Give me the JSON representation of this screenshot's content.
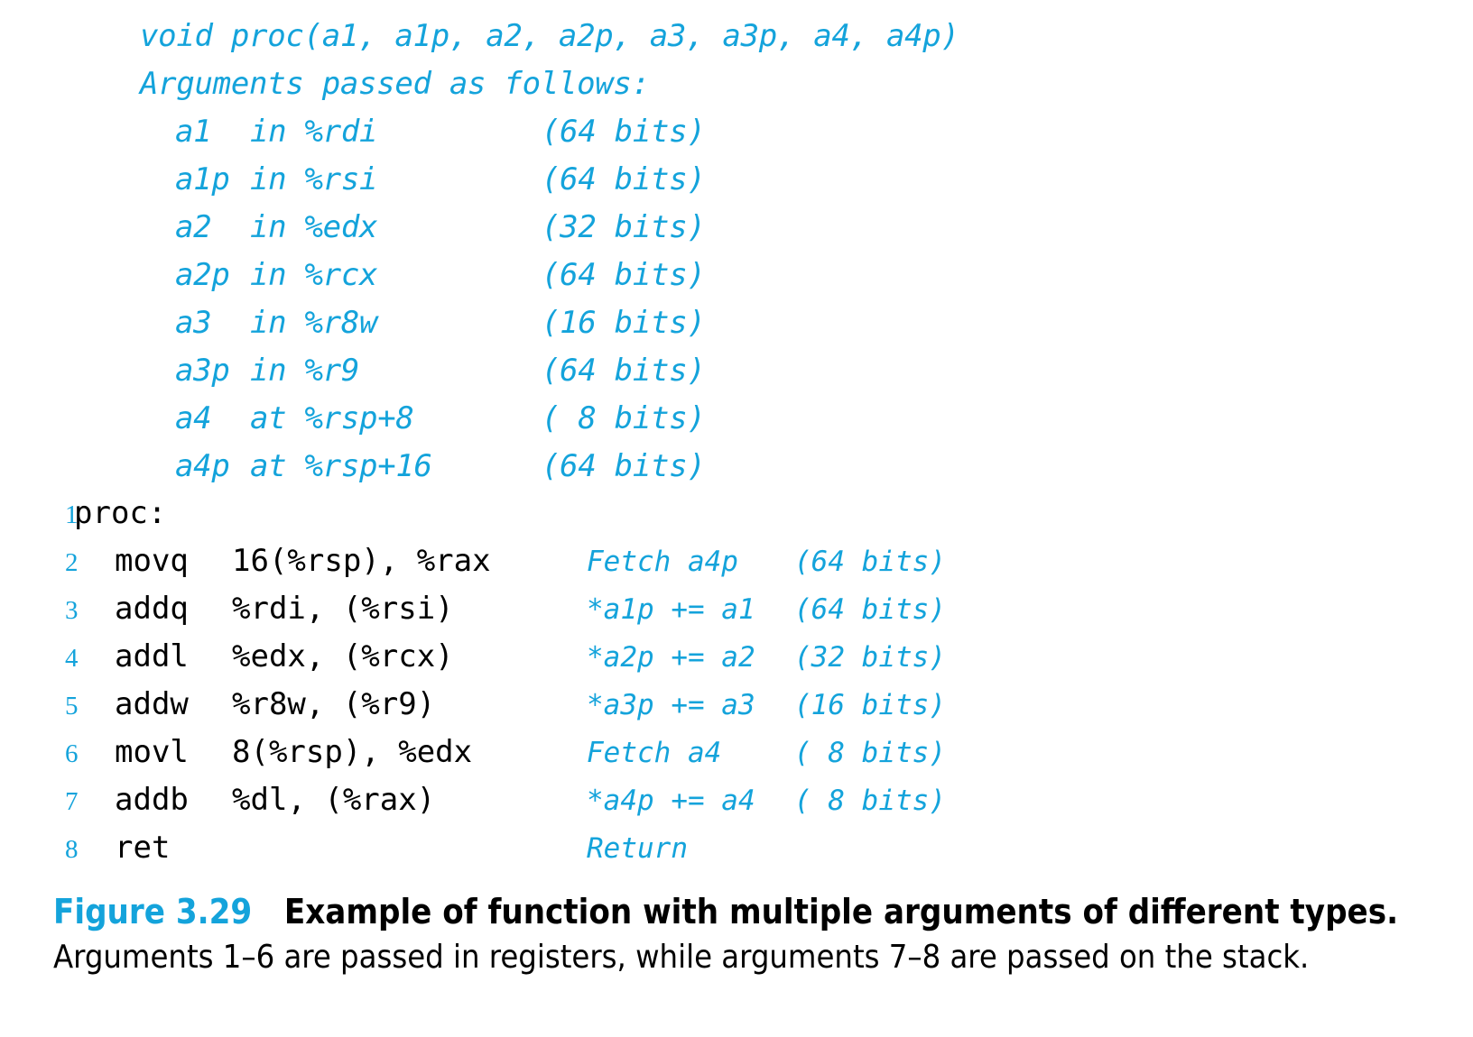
{
  "colors": {
    "accent": "#14a3db",
    "text": "#000000",
    "background": "#ffffff"
  },
  "c_source": {
    "signature": "void proc(a1, a1p, a2, a2p, a3, a3p, a4, a4p)",
    "intro": "Arguments passed as follows:",
    "arguments": [
      {
        "name": "a1",
        "location": "in %rdi",
        "bits": "(64 bits)"
      },
      {
        "name": "a1p",
        "location": "in %rsi",
        "bits": "(64 bits)"
      },
      {
        "name": "a2",
        "location": "in %edx",
        "bits": "(32 bits)"
      },
      {
        "name": "a2p",
        "location": "in %rcx",
        "bits": "(64 bits)"
      },
      {
        "name": "a3",
        "location": "in %r8w",
        "bits": "(16 bits)"
      },
      {
        "name": "a3p",
        "location": "in %r9",
        "bits": "(64 bits)"
      },
      {
        "name": "a4",
        "location": "at %rsp+8",
        "bits": "( 8 bits)"
      },
      {
        "name": "a4p",
        "location": "at %rsp+16",
        "bits": "(64 bits)"
      }
    ]
  },
  "assembly": {
    "lines": [
      {
        "num": "1",
        "label": "proc:",
        "mnemonic": "",
        "operands": "",
        "comment": "",
        "bits": ""
      },
      {
        "num": "2",
        "label": "",
        "mnemonic": "movq",
        "operands": "16(%rsp), %rax",
        "comment": "Fetch a4p",
        "bits": "(64 bits)"
      },
      {
        "num": "3",
        "label": "",
        "mnemonic": "addq",
        "operands": "%rdi, (%rsi)",
        "comment": "*a1p += a1",
        "bits": "(64 bits)"
      },
      {
        "num": "4",
        "label": "",
        "mnemonic": "addl",
        "operands": "%edx, (%rcx)",
        "comment": "*a2p += a2",
        "bits": "(32 bits)"
      },
      {
        "num": "5",
        "label": "",
        "mnemonic": "addw",
        "operands": "%r8w, (%r9)",
        "comment": "*a3p += a3",
        "bits": "(16 bits)"
      },
      {
        "num": "6",
        "label": "",
        "mnemonic": "movl",
        "operands": "8(%rsp), %edx",
        "comment": "Fetch a4",
        "bits": "( 8 bits)"
      },
      {
        "num": "7",
        "label": "",
        "mnemonic": "addb",
        "operands": "%dl, (%rax)",
        "comment": "*a4p += a4",
        "bits": "( 8 bits)"
      },
      {
        "num": "8",
        "label": "",
        "mnemonic": "ret",
        "operands": "",
        "comment": "Return",
        "bits": ""
      }
    ]
  },
  "caption": {
    "number": "Figure 3.29",
    "title": "Example of function with multiple arguments of different types.",
    "description": "Arguments 1–6 are passed in registers, while arguments 7–8 are passed on the stack."
  }
}
